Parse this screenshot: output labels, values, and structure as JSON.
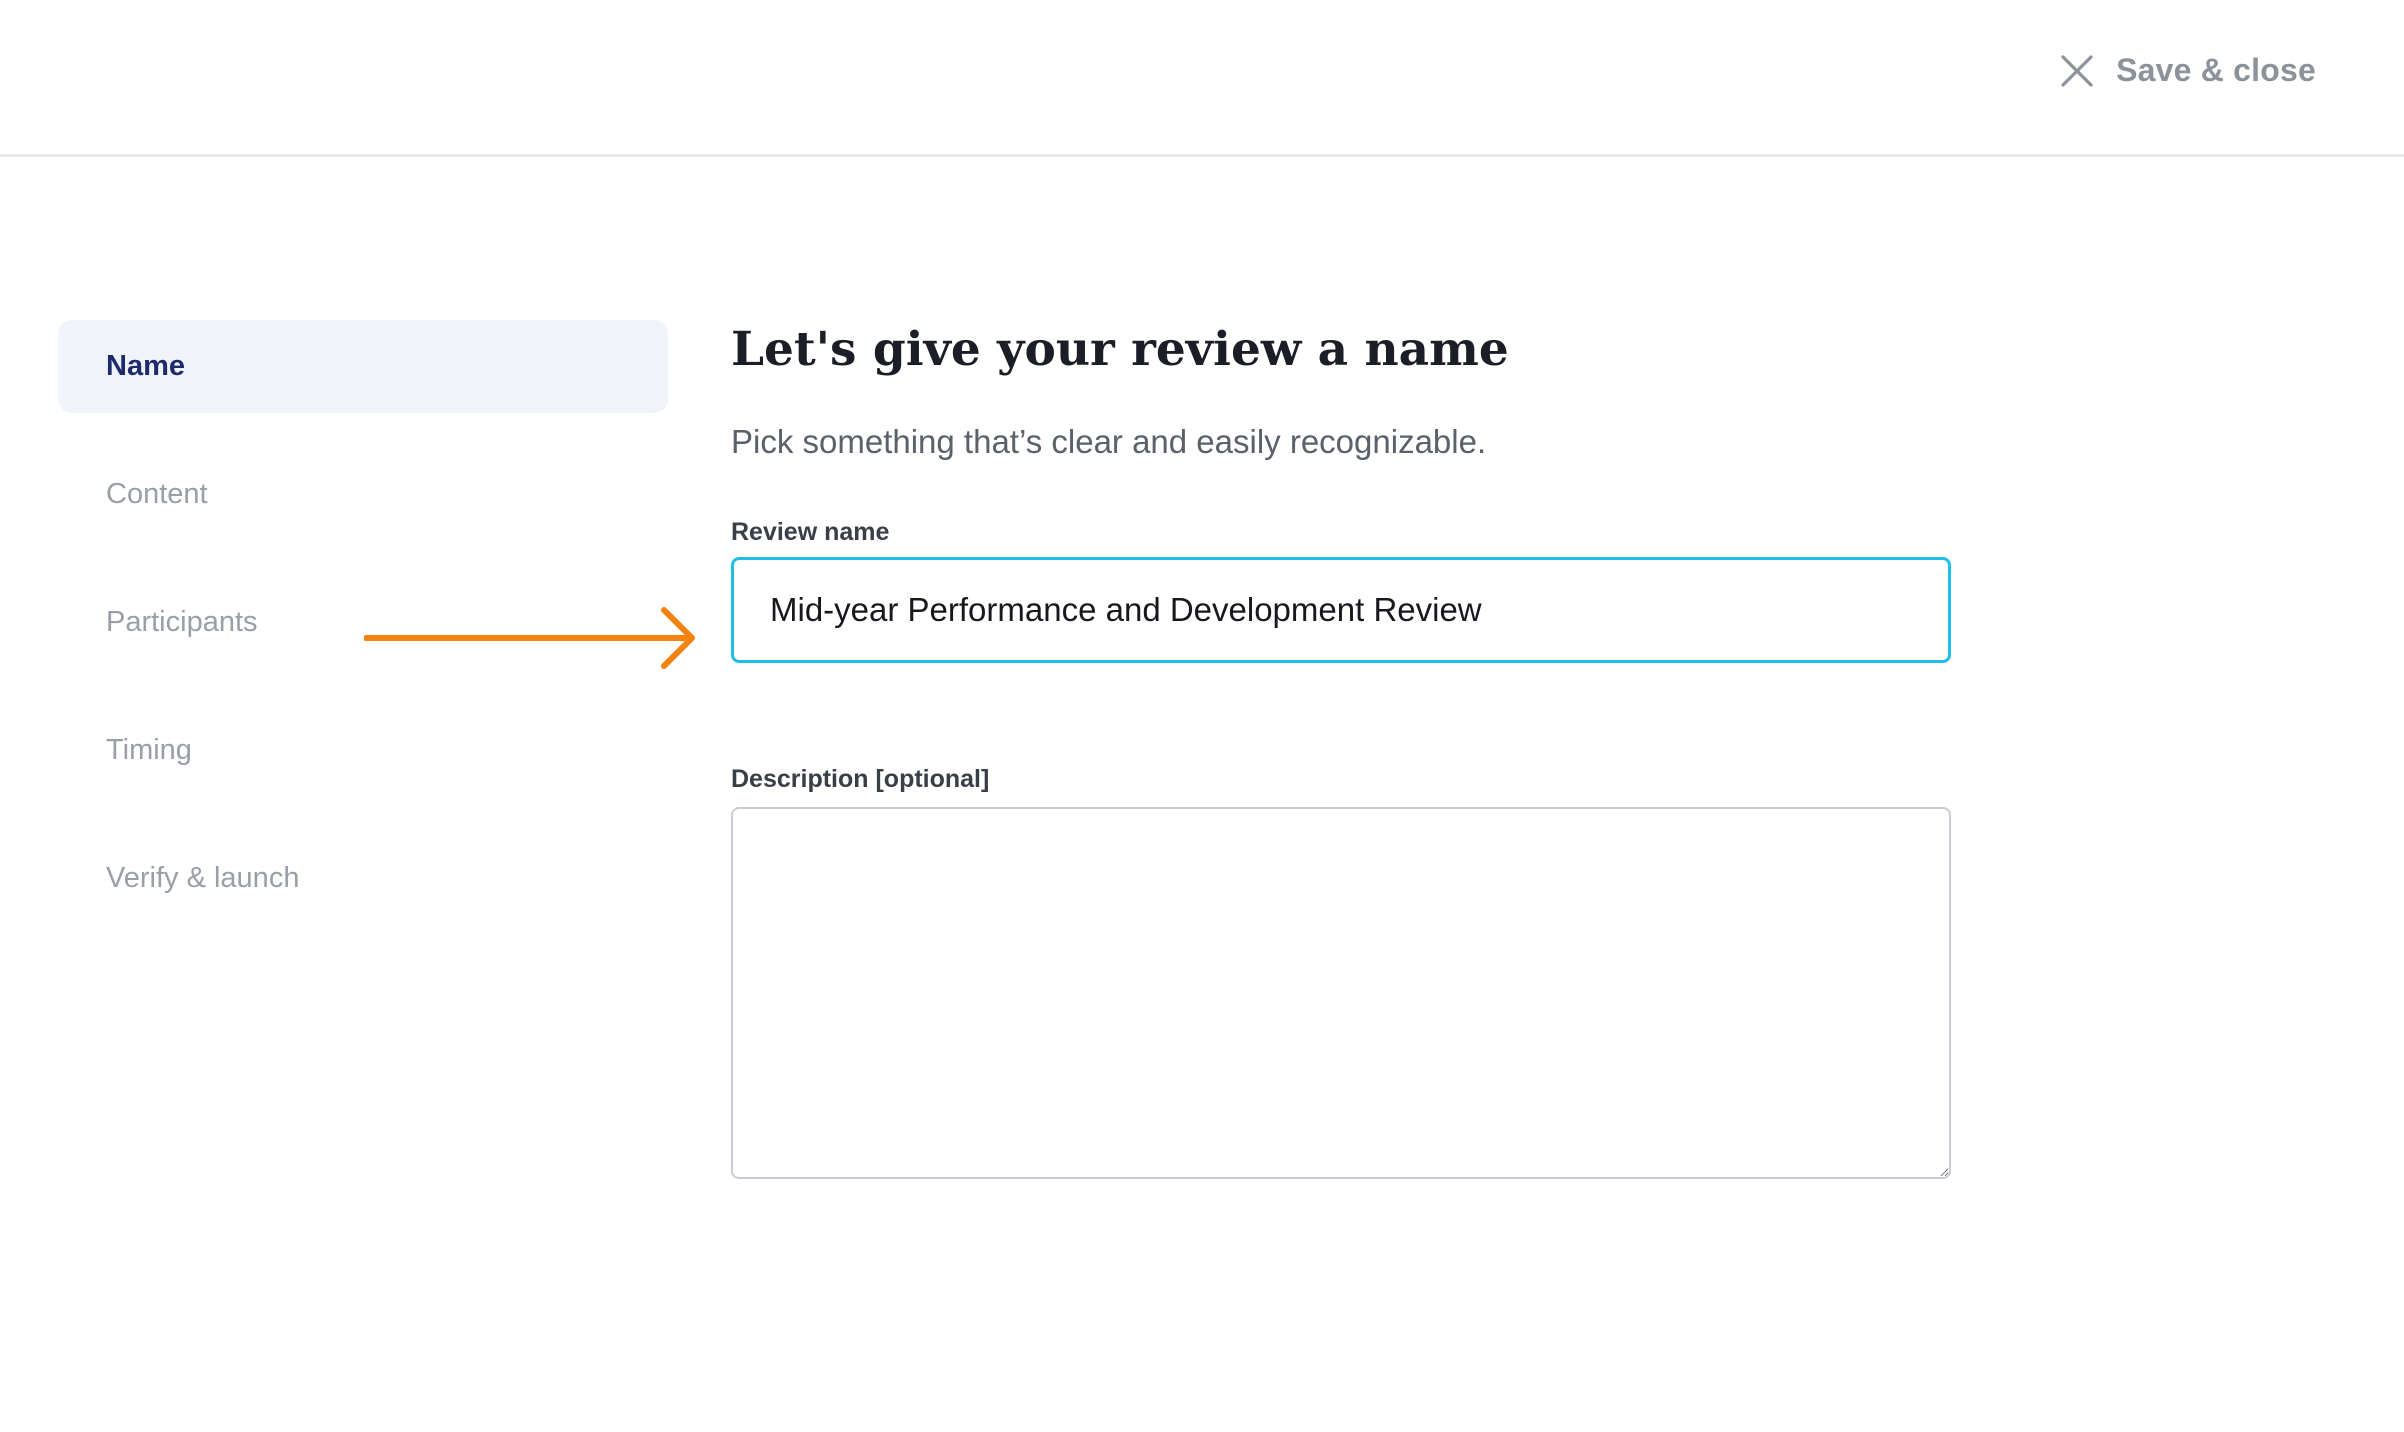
{
  "header": {
    "save_close_label": "Save & close",
    "close_icon": "close-icon"
  },
  "sidebar": {
    "items": [
      {
        "label": "Name",
        "active": true
      },
      {
        "label": "Content",
        "active": false
      },
      {
        "label": "Participants",
        "active": false
      },
      {
        "label": "Timing",
        "active": false
      },
      {
        "label": "Verify & launch",
        "active": false
      }
    ]
  },
  "annotation": {
    "arrow_icon": "arrow-right-icon",
    "arrow_color": "#f5830f"
  },
  "main": {
    "title": "Let's give your review a name",
    "subtitle": "Pick something that’s clear and easily recognizable.",
    "review_name": {
      "label": "Review name",
      "value": "Mid-year Performance and Development Review"
    },
    "description": {
      "label": "Description [optional]",
      "value": ""
    }
  },
  "colors": {
    "accent_focus": "#1fbfe8",
    "active_nav_text": "#1d2a6b",
    "active_nav_bg": "#f0f3fa"
  }
}
